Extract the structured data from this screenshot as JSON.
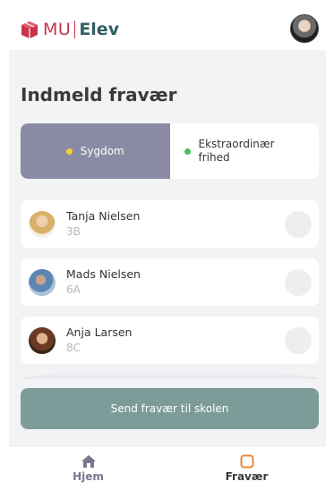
{
  "header": {
    "logo_mu": "MU",
    "logo_elev": "Elev",
    "logo_icon": "box-logo-icon",
    "avatar_icon": "user-avatar"
  },
  "main": {
    "title": "Indmeld fravær",
    "toggle": {
      "option_1": "Sygdom",
      "option_2": "Ekstraordinær frihed",
      "selected": "Sygdom"
    },
    "students": [
      {
        "name": "Tanja Nielsen",
        "class": "3B"
      },
      {
        "name": "Mads Nielsen",
        "class": "6A"
      },
      {
        "name": "Anja Larsen",
        "class": "8C"
      }
    ],
    "send_button": "Send fravær til skolen"
  },
  "nav": {
    "home_label": "Hjem",
    "home_icon": "home-icon",
    "absence_label": "Fravær",
    "absence_icon": "square-icon"
  },
  "colors": {
    "brand_red": "#c7344a",
    "brand_teal": "#2f5f64",
    "toggle_active": "#8a8aa4",
    "send_button": "#7d9c99",
    "dot_sick": "#f2d22e",
    "dot_leave": "#4cbb5a",
    "nav_active_icon": "#e8873a"
  }
}
